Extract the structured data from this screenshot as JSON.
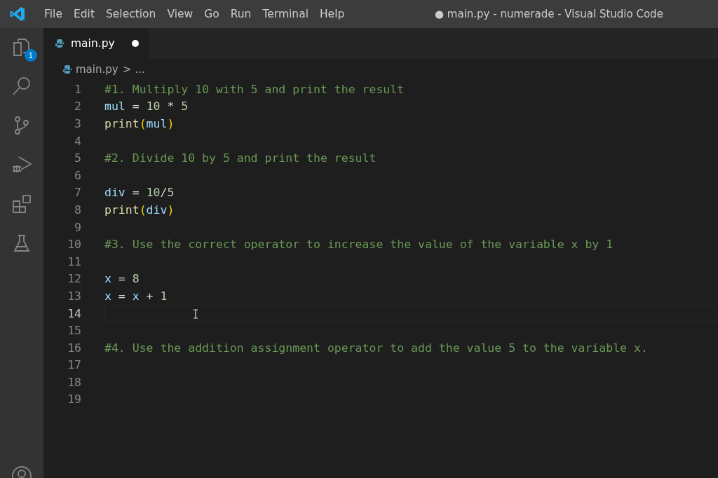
{
  "window": {
    "title": "● main.py - numerade - Visual Studio Code"
  },
  "menu": [
    "File",
    "Edit",
    "Selection",
    "View",
    "Go",
    "Run",
    "Terminal",
    "Help"
  ],
  "activity_bar": {
    "explorer_badge": "1"
  },
  "tabs": [
    {
      "label": "main.py",
      "selected": true,
      "modified": true
    }
  ],
  "breadcrumbs": {
    "file": "main.py",
    "separator": ">",
    "symbol": "..."
  },
  "editor": {
    "lines": [
      {
        "number": "1",
        "current": false,
        "tokens": [
          {
            "kind": "comment",
            "text": "#1. Multiply 10 with 5 and print the result"
          }
        ]
      },
      {
        "number": "2",
        "current": false,
        "tokens": [
          {
            "kind": "variable",
            "text": "mul"
          },
          {
            "kind": "plain",
            "text": " = "
          },
          {
            "kind": "number",
            "text": "10"
          },
          {
            "kind": "plain",
            "text": " * "
          },
          {
            "kind": "number",
            "text": "5"
          }
        ]
      },
      {
        "number": "3",
        "current": false,
        "tokens": [
          {
            "kind": "function",
            "text": "print"
          },
          {
            "kind": "paren",
            "text": "("
          },
          {
            "kind": "variable",
            "text": "mul"
          },
          {
            "kind": "paren",
            "text": ")"
          }
        ]
      },
      {
        "number": "4",
        "current": false
      },
      {
        "number": "5",
        "current": false,
        "tokens": [
          {
            "kind": "comment",
            "text": "#2. Divide 10 by 5 and print the result"
          }
        ]
      },
      {
        "number": "6",
        "current": false
      },
      {
        "number": "7",
        "current": false,
        "tokens": [
          {
            "kind": "variable",
            "text": "div"
          },
          {
            "kind": "plain",
            "text": " = "
          },
          {
            "kind": "number",
            "text": "10"
          },
          {
            "kind": "plain",
            "text": "/"
          },
          {
            "kind": "number",
            "text": "5"
          }
        ]
      },
      {
        "number": "8",
        "current": false,
        "tokens": [
          {
            "kind": "function",
            "text": "print"
          },
          {
            "kind": "paren",
            "text": "("
          },
          {
            "kind": "variable",
            "text": "div"
          },
          {
            "kind": "paren",
            "text": ")"
          }
        ]
      },
      {
        "number": "9",
        "current": false
      },
      {
        "number": "10",
        "current": false,
        "tokens": [
          {
            "kind": "comment",
            "text": "#3. Use the correct operator to increase the value of the variable x by 1"
          }
        ]
      },
      {
        "number": "11",
        "current": false
      },
      {
        "number": "12",
        "current": false,
        "tokens": [
          {
            "kind": "variable",
            "text": "x"
          },
          {
            "kind": "plain",
            "text": " = "
          },
          {
            "kind": "number",
            "text": "8"
          }
        ]
      },
      {
        "number": "13",
        "current": false,
        "tokens": [
          {
            "kind": "variable",
            "text": "x"
          },
          {
            "kind": "plain",
            "text": " = "
          },
          {
            "kind": "variable",
            "text": "x"
          },
          {
            "kind": "plain",
            "text": " + "
          },
          {
            "kind": "number",
            "text": "1"
          }
        ]
      },
      {
        "number": "14",
        "current": true
      },
      {
        "number": "15",
        "current": false
      },
      {
        "number": "16",
        "current": false,
        "tokens": [
          {
            "kind": "comment",
            "text": "#4. Use the addition assignment operator to add the value 5 to the variable x."
          }
        ]
      },
      {
        "number": "17",
        "current": false
      },
      {
        "number": "18",
        "current": false
      },
      {
        "number": "19",
        "current": false
      }
    ]
  }
}
